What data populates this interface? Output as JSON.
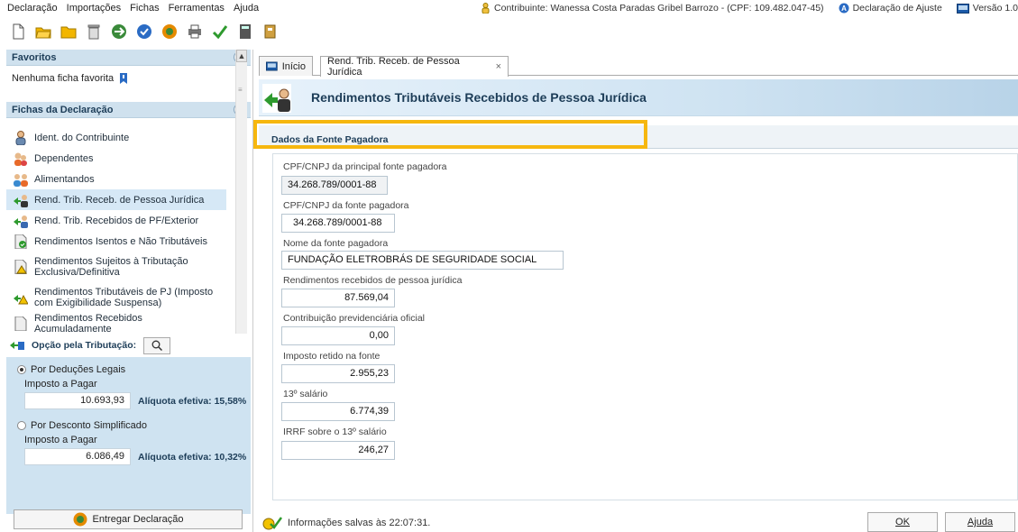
{
  "menu": [
    "Declaração",
    "Importações",
    "Fichas",
    "Ferramentas",
    "Ajuda"
  ],
  "header": {
    "contribuinte": "Contribuinte: Wanessa Costa Paradas Gribel Barrozo - (CPF: 109.482.047-45)",
    "tipo": "Declaração de Ajuste",
    "versao": "Versão 1.0"
  },
  "favoritos": {
    "title": "Favoritos",
    "empty": "Nenhuma ficha favorita"
  },
  "fichas": {
    "title": "Fichas da Declaração",
    "items": [
      "Ident. do Contribuinte",
      "Dependentes",
      "Alimentandos",
      "Rend. Trib. Receb. de Pessoa Jurídica",
      "Rend. Trib. Recebidos de PF/Exterior",
      "Rendimentos Isentos e Não Tributáveis",
      "Rendimentos Sujeitos à Tributação Exclusiva/Definitiva",
      "Rendimentos Tributáveis de PJ (Imposto com Exigibilidade Suspensa)",
      "Rendimentos Recebidos Acumuladamente"
    ]
  },
  "tributacao": {
    "title": "Opção pela Tributação:",
    "opcao1": {
      "label": "Por Deduções Legais",
      "imposto_label": "Imposto a Pagar",
      "valor": "10.693,93",
      "aliquota": "Alíquota efetiva: 15,58%"
    },
    "opcao2": {
      "label": "Por Desconto Simplificado",
      "imposto_label": "Imposto a Pagar",
      "valor": "6.086,49",
      "aliquota": "Alíquota efetiva: 10,32%"
    }
  },
  "entregar": "Entregar Declaração",
  "tabs": {
    "inicio": "Início",
    "current": "Rend. Trib. Receb. de Pessoa Jurídica",
    "close": "×"
  },
  "banner": {
    "title": "Rendimentos Tributáveis Recebidos de Pessoa Jurídica"
  },
  "section": {
    "title": "Dados da Fonte Pagadora"
  },
  "form": {
    "cpf_principal_label": "CPF/CNPJ da principal fonte pagadora",
    "cpf_principal": "34.268.789/0001-88",
    "cpf_fonte_label": "CPF/CNPJ da fonte pagadora",
    "cpf_fonte": "34.268.789/0001-88",
    "nome_label": "Nome da fonte pagadora",
    "nome": "FUNDAÇÃO ELETROBRÁS DE SEGURIDADE SOCIAL",
    "rend_label": "Rendimentos recebidos de pessoa jurídica",
    "rend": "87.569,04",
    "contrib_label": "Contribuição previdenciária oficial",
    "contrib": "0,00",
    "imposto_label": "Imposto retido na fonte",
    "imposto": "2.955,23",
    "decimo_label": "13º salário",
    "decimo": "6.774,39",
    "irrf_label": "IRRF sobre o 13º salário",
    "irrf": "246,27"
  },
  "status": "Informações salvas às 22:07:31.",
  "buttons": {
    "ok": "OK",
    "ajuda": "Ajuda"
  },
  "colors": {
    "highlight": "#f6b70f",
    "panel": "#cfe3f1",
    "title": "#1d3d58"
  }
}
